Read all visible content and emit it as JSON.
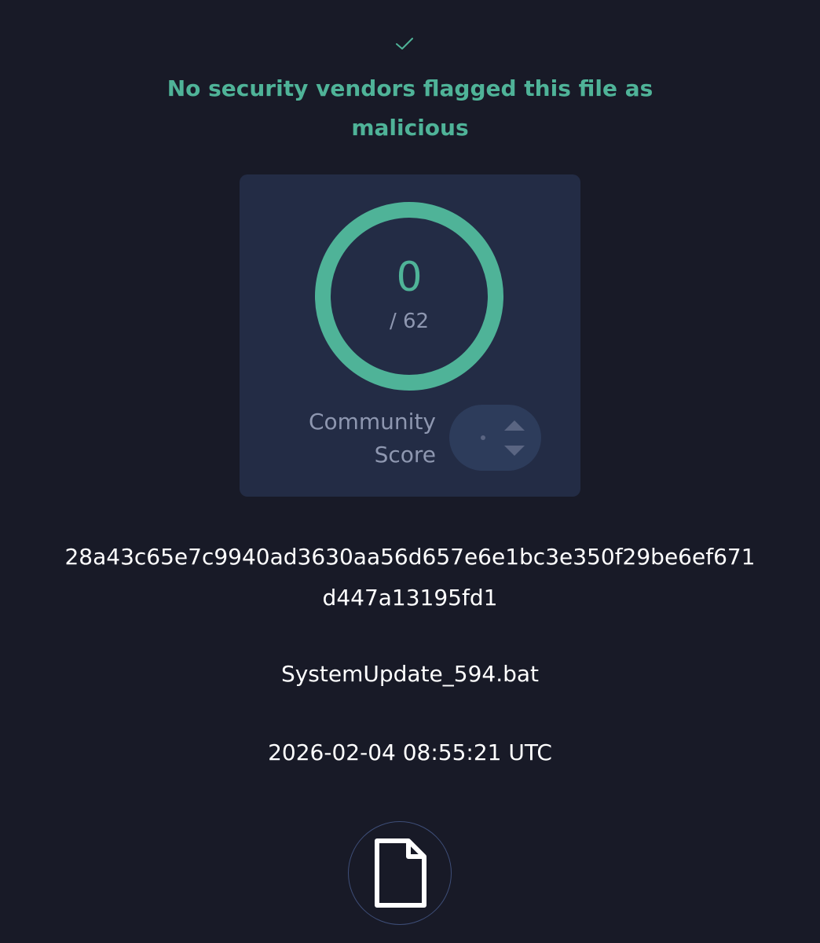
{
  "verdict": {
    "icon": "check-icon",
    "line1": "No security vendors flagged this file as",
    "line2": "malicious"
  },
  "score": {
    "detections": "0",
    "total": "/ 62",
    "detection_ratio": 0,
    "community_label_line1": "Community",
    "community_label_line2": "Score"
  },
  "file": {
    "hash_line1": "28a43c65e7c9940ad3630aa56d657e6e1bc3e350f29be6ef671",
    "hash_line2": "d447a13195fd1",
    "name": "SystemUpdate_594.bat",
    "date": "2026-02-04 08:55:21 UTC",
    "type_icon": "file-icon"
  },
  "colors": {
    "background": "#181a27",
    "accent": "#4fb398",
    "card": "#232c45",
    "muted_text": "#8e97b0"
  }
}
